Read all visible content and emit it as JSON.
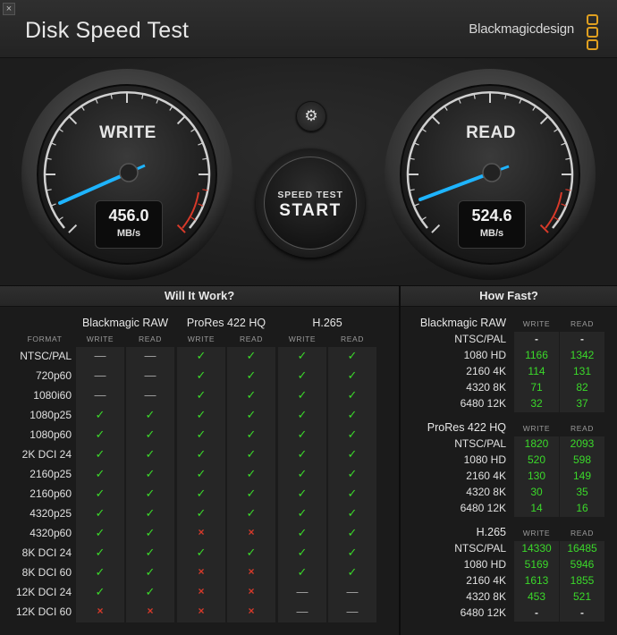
{
  "window": {
    "close_glyph": "×",
    "title": "Disk Speed Test",
    "brand": "Blackmagicdesign"
  },
  "gauges": {
    "write": {
      "label": "WRITE",
      "value": "456.0",
      "unit": "MB/s"
    },
    "read": {
      "label": "READ",
      "value": "524.6",
      "unit": "MB/s"
    }
  },
  "settings": {
    "icon": "gear-icon",
    "glyph": "⚙"
  },
  "start_button": {
    "small": "SPEED TEST",
    "big": "START"
  },
  "colors": {
    "accent": "#1eb4ff",
    "ok": "#3bd92a",
    "fail": "#d83a2a",
    "logo": "#e0a020"
  },
  "will_it_work": {
    "title": "Will It Work?",
    "format_header": "FORMAT",
    "groups": [
      "Blackmagic RAW",
      "ProRes 422 HQ",
      "H.265"
    ],
    "col_headers": [
      "WRITE",
      "READ",
      "WRITE",
      "READ",
      "WRITE",
      "READ"
    ],
    "rows": [
      {
        "format": "NTSC/PAL",
        "cells": [
          "na",
          "na",
          "ok",
          "ok",
          "ok",
          "ok"
        ]
      },
      {
        "format": "720p60",
        "cells": [
          "na",
          "na",
          "ok",
          "ok",
          "ok",
          "ok"
        ]
      },
      {
        "format": "1080i60",
        "cells": [
          "na",
          "na",
          "ok",
          "ok",
          "ok",
          "ok"
        ]
      },
      {
        "format": "1080p25",
        "cells": [
          "ok",
          "ok",
          "ok",
          "ok",
          "ok",
          "ok"
        ]
      },
      {
        "format": "1080p60",
        "cells": [
          "ok",
          "ok",
          "ok",
          "ok",
          "ok",
          "ok"
        ]
      },
      {
        "format": "2K DCI 24",
        "cells": [
          "ok",
          "ok",
          "ok",
          "ok",
          "ok",
          "ok"
        ]
      },
      {
        "format": "2160p25",
        "cells": [
          "ok",
          "ok",
          "ok",
          "ok",
          "ok",
          "ok"
        ]
      },
      {
        "format": "2160p60",
        "cells": [
          "ok",
          "ok",
          "ok",
          "ok",
          "ok",
          "ok"
        ]
      },
      {
        "format": "4320p25",
        "cells": [
          "ok",
          "ok",
          "ok",
          "ok",
          "ok",
          "ok"
        ]
      },
      {
        "format": "4320p60",
        "cells": [
          "ok",
          "ok",
          "no",
          "no",
          "ok",
          "ok"
        ]
      },
      {
        "format": "8K DCI 24",
        "cells": [
          "ok",
          "ok",
          "ok",
          "ok",
          "ok",
          "ok"
        ]
      },
      {
        "format": "8K DCI 60",
        "cells": [
          "ok",
          "ok",
          "no",
          "no",
          "ok",
          "ok"
        ]
      },
      {
        "format": "12K DCI 24",
        "cells": [
          "ok",
          "ok",
          "no",
          "no",
          "na",
          "na"
        ]
      },
      {
        "format": "12K DCI 60",
        "cells": [
          "no",
          "no",
          "no",
          "no",
          "na",
          "na"
        ]
      }
    ],
    "glyphs": {
      "ok": "✓",
      "no": "×",
      "na": "—"
    }
  },
  "how_fast": {
    "title": "How Fast?",
    "col_headers": [
      "WRITE",
      "READ"
    ],
    "groups": [
      {
        "name": "Blackmagic RAW",
        "rows": [
          {
            "label": "NTSC/PAL",
            "write": "-",
            "read": "-"
          },
          {
            "label": "1080 HD",
            "write": "1166",
            "read": "1342"
          },
          {
            "label": "2160 4K",
            "write": "114",
            "read": "131"
          },
          {
            "label": "4320 8K",
            "write": "71",
            "read": "82"
          },
          {
            "label": "6480 12K",
            "write": "32",
            "read": "37"
          }
        ]
      },
      {
        "name": "ProRes 422 HQ",
        "rows": [
          {
            "label": "NTSC/PAL",
            "write": "1820",
            "read": "2093"
          },
          {
            "label": "1080 HD",
            "write": "520",
            "read": "598"
          },
          {
            "label": "2160 4K",
            "write": "130",
            "read": "149"
          },
          {
            "label": "4320 8K",
            "write": "30",
            "read": "35"
          },
          {
            "label": "6480 12K",
            "write": "14",
            "read": "16"
          }
        ]
      },
      {
        "name": "H.265",
        "rows": [
          {
            "label": "NTSC/PAL",
            "write": "14330",
            "read": "16485"
          },
          {
            "label": "1080 HD",
            "write": "5169",
            "read": "5946"
          },
          {
            "label": "2160 4K",
            "write": "1613",
            "read": "1855"
          },
          {
            "label": "4320 8K",
            "write": "453",
            "read": "521"
          },
          {
            "label": "6480 12K",
            "write": "-",
            "read": "-"
          }
        ]
      }
    ]
  }
}
